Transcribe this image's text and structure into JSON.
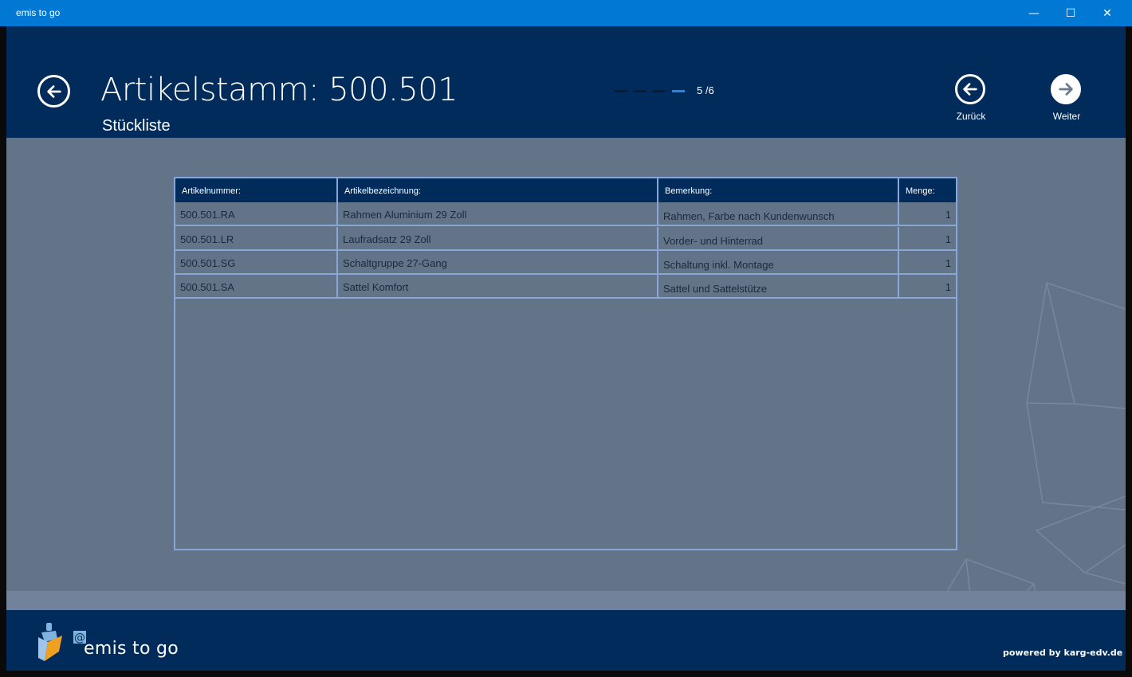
{
  "window": {
    "title": "emis to go",
    "controls": {
      "minimize": "—",
      "maximize": "☐",
      "close": "✕"
    }
  },
  "header": {
    "title": "Artikelstamm: 500.501",
    "subtitle": "Stückliste",
    "pager": {
      "total_dashes": 4,
      "active_dash": 4,
      "label": "5 /6"
    },
    "prev_label": "Zurück",
    "next_label": "Weiter"
  },
  "table": {
    "columns": [
      "Artikelnummer:",
      "Artikelbezeichnung:",
      "Bemerkung:",
      "Menge:"
    ],
    "rows": [
      {
        "nummer": "500.501.RA",
        "bezeichnung": "Rahmen Aluminium 29 Zoll",
        "bemerkung": "Rahmen, Farbe nach Kundenwunsch",
        "menge": "1"
      },
      {
        "nummer": "500.501.LR",
        "bezeichnung": "Laufradsatz 29 Zoll",
        "bemerkung": "Vorder- und Hinterrad",
        "menge": "1"
      },
      {
        "nummer": "500.501.SG",
        "bezeichnung": "Schaltgruppe 27-Gang",
        "bemerkung": "Schaltung inkl. Montage",
        "menge": "1"
      },
      {
        "nummer": "500.501.SA",
        "bezeichnung": "Sattel Komfort",
        "bemerkung": "Sattel und Sattelstütze",
        "menge": "1"
      }
    ]
  },
  "footer": {
    "logo_at": "@",
    "logo_text": "emis to go",
    "powered_by": "powered by karg-edv.de"
  },
  "colors": {
    "titlebar": "#0078d4",
    "header": "#002b5a",
    "content": "#647488",
    "table_border": "#8aa6d6",
    "pager_active": "#1e88e5"
  },
  "icons": {
    "back": "arrow-left-circle-icon",
    "prev": "arrow-left-circle-icon",
    "next": "arrow-right-circle-icon"
  }
}
